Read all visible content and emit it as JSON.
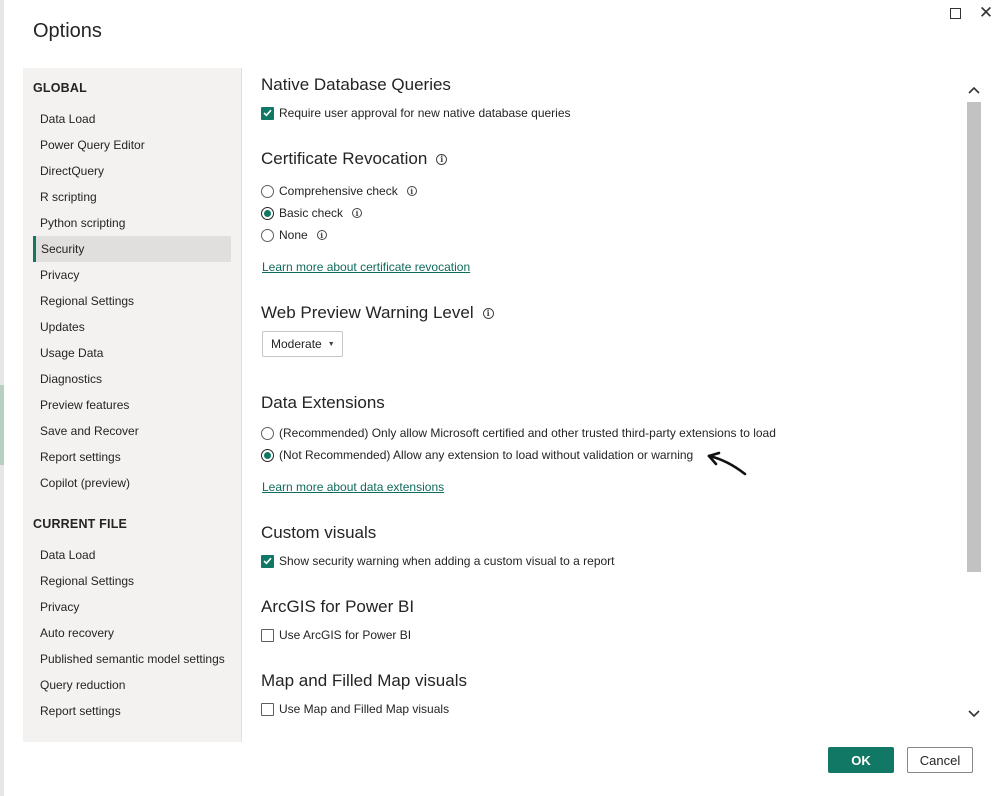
{
  "dialog": {
    "title": "Options"
  },
  "sidebar": {
    "global_header": "GLOBAL",
    "global_items": [
      {
        "label": "Data Load",
        "selected": false
      },
      {
        "label": "Power Query Editor",
        "selected": false
      },
      {
        "label": "DirectQuery",
        "selected": false
      },
      {
        "label": "R scripting",
        "selected": false
      },
      {
        "label": "Python scripting",
        "selected": false
      },
      {
        "label": "Security",
        "selected": true
      },
      {
        "label": "Privacy",
        "selected": false
      },
      {
        "label": "Regional Settings",
        "selected": false
      },
      {
        "label": "Updates",
        "selected": false
      },
      {
        "label": "Usage Data",
        "selected": false
      },
      {
        "label": "Diagnostics",
        "selected": false
      },
      {
        "label": "Preview features",
        "selected": false
      },
      {
        "label": "Save and Recover",
        "selected": false
      },
      {
        "label": "Report settings",
        "selected": false
      },
      {
        "label": "Copilot (preview)",
        "selected": false
      }
    ],
    "current_file_header": "CURRENT FILE",
    "current_file_items": [
      {
        "label": "Data Load"
      },
      {
        "label": "Regional Settings"
      },
      {
        "label": "Privacy"
      },
      {
        "label": "Auto recovery"
      },
      {
        "label": "Published semantic model settings"
      },
      {
        "label": "Query reduction"
      },
      {
        "label": "Report settings"
      }
    ]
  },
  "content": {
    "native_db": {
      "title": "Native Database Queries",
      "option": {
        "label": "Require user approval for new native database queries",
        "checked": true
      }
    },
    "cert_revocation": {
      "title": "Certificate Revocation",
      "options": [
        {
          "label": "Comprehensive check",
          "checked": false
        },
        {
          "label": "Basic check",
          "checked": true
        },
        {
          "label": "None",
          "checked": false
        }
      ],
      "link": "Learn more about certificate revocation"
    },
    "web_preview": {
      "title": "Web Preview Warning Level",
      "selected_value": "Moderate"
    },
    "data_extensions": {
      "title": "Data Extensions",
      "options": [
        {
          "label": "(Recommended) Only allow Microsoft certified and other trusted third-party extensions to load",
          "checked": false
        },
        {
          "label": "(Not Recommended) Allow any extension to load without validation or warning",
          "checked": true
        }
      ],
      "link": "Learn more about data extensions"
    },
    "custom_visuals": {
      "title": "Custom visuals",
      "option": {
        "label": "Show security warning when adding a custom visual to a report",
        "checked": true
      }
    },
    "arcgis": {
      "title": "ArcGIS for Power BI",
      "option": {
        "label": "Use ArcGIS for Power BI",
        "checked": false
      }
    },
    "map_visuals": {
      "title": "Map and Filled Map visuals",
      "option": {
        "label": "Use Map and Filled Map visuals",
        "checked": false
      }
    }
  },
  "footer": {
    "ok_label": "OK",
    "cancel_label": "Cancel"
  },
  "colors": {
    "accent": "#117865",
    "link": "#0f6b5c",
    "sidebar_bg": "#f3f2f1"
  }
}
